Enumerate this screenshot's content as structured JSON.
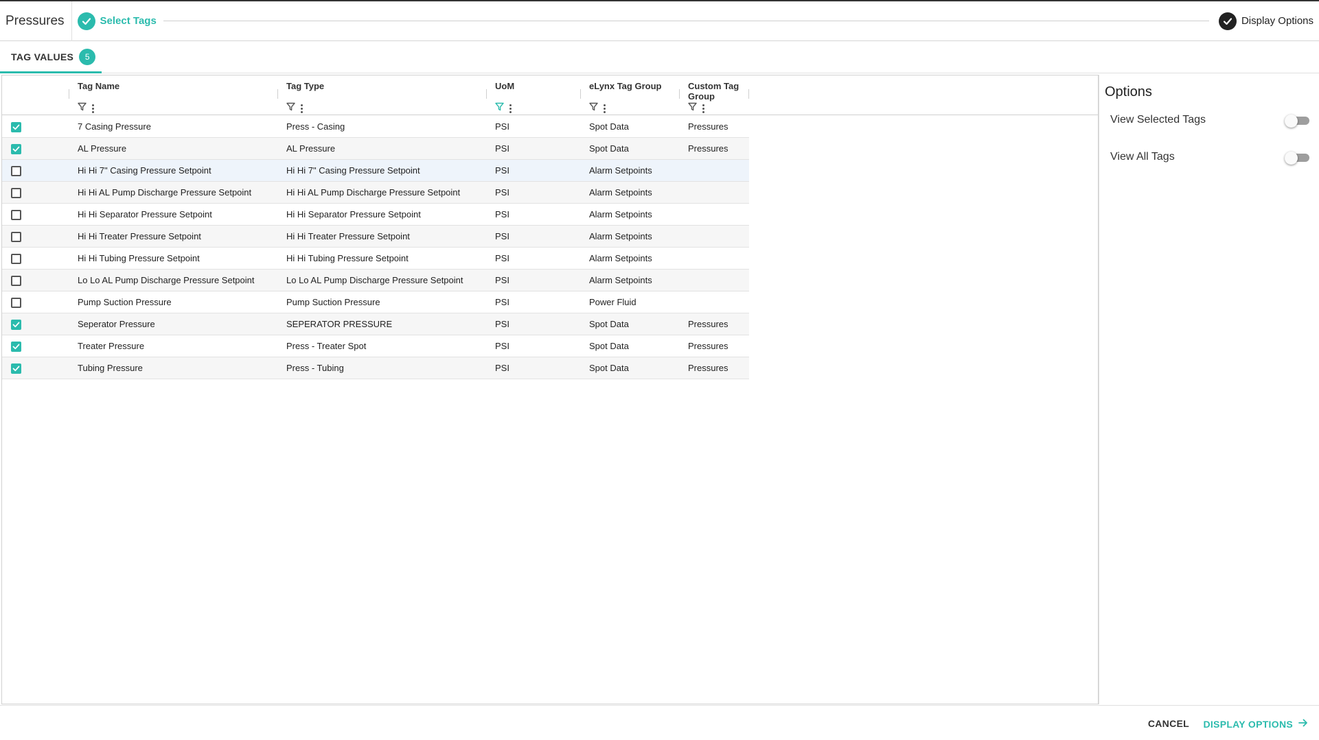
{
  "header": {
    "title": "Pressures",
    "steps": [
      {
        "label": "Select Tags",
        "state": "completed"
      },
      {
        "label": "Display Options",
        "state": "current"
      }
    ]
  },
  "tabs": [
    {
      "label": "TAG VALUES",
      "badge": "5"
    }
  ],
  "grid": {
    "columns": [
      {
        "label": "Tag Name",
        "filter_active": false
      },
      {
        "label": "Tag Type",
        "filter_active": false
      },
      {
        "label": "UoM",
        "filter_active": true
      },
      {
        "label": "eLynx Tag Group",
        "filter_active": false
      },
      {
        "label": "Custom Tag Group",
        "filter_active": false
      }
    ],
    "rows": [
      {
        "checked": true,
        "name": "7 Casing Pressure",
        "type": "Press - Casing",
        "uom": "PSI",
        "group": "Spot Data",
        "custom": "Pressures"
      },
      {
        "checked": true,
        "name": "AL Pressure",
        "type": "AL Pressure",
        "uom": "PSI",
        "group": "Spot Data",
        "custom": "Pressures"
      },
      {
        "checked": false,
        "name": "Hi Hi 7\" Casing Pressure Setpoint",
        "type": "Hi Hi 7\" Casing Pressure Setpoint",
        "uom": "PSI",
        "group": "Alarm Setpoints",
        "custom": ""
      },
      {
        "checked": false,
        "name": "Hi Hi AL Pump Discharge Pressure Setpoint",
        "type": "Hi Hi AL Pump Discharge Pressure Setpoint",
        "uom": "PSI",
        "group": "Alarm Setpoints",
        "custom": ""
      },
      {
        "checked": false,
        "name": "Hi Hi Separator Pressure Setpoint",
        "type": "Hi Hi Separator Pressure Setpoint",
        "uom": "PSI",
        "group": "Alarm Setpoints",
        "custom": ""
      },
      {
        "checked": false,
        "name": "Hi Hi Treater Pressure Setpoint",
        "type": "Hi Hi Treater Pressure Setpoint",
        "uom": "PSI",
        "group": "Alarm Setpoints",
        "custom": ""
      },
      {
        "checked": false,
        "name": "Hi Hi Tubing Pressure Setpoint",
        "type": "Hi Hi Tubing Pressure Setpoint",
        "uom": "PSI",
        "group": "Alarm Setpoints",
        "custom": ""
      },
      {
        "checked": false,
        "name": "Lo Lo AL Pump Discharge Pressure Setpoint",
        "type": "Lo Lo AL Pump Discharge Pressure Setpoint",
        "uom": "PSI",
        "group": "Alarm Setpoints",
        "custom": ""
      },
      {
        "checked": false,
        "name": "Pump Suction Pressure",
        "type": "Pump Suction Pressure",
        "uom": "PSI",
        "group": "Power Fluid",
        "custom": ""
      },
      {
        "checked": true,
        "name": "Seperator Pressure",
        "type": "SEPERATOR PRESSURE",
        "uom": "PSI",
        "group": "Spot Data",
        "custom": "Pressures"
      },
      {
        "checked": true,
        "name": "Treater Pressure",
        "type": "Press - Treater Spot",
        "uom": "PSI",
        "group": "Spot Data",
        "custom": "Pressures"
      },
      {
        "checked": true,
        "name": "Tubing Pressure",
        "type": "Press - Tubing",
        "uom": "PSI",
        "group": "Spot Data",
        "custom": "Pressures"
      }
    ]
  },
  "options": {
    "title": "Options",
    "items": [
      {
        "label": "View Selected Tags",
        "on": false
      },
      {
        "label": "View All Tags",
        "on": false
      }
    ]
  },
  "footer": {
    "cancel_label": "CANCEL",
    "next_label": "DISPLAY OPTIONS"
  },
  "colors": {
    "accent": "#2bbbad",
    "dark": "#222222",
    "row_alt": "#f6f6f6",
    "row_hover": "#eef4fb"
  }
}
